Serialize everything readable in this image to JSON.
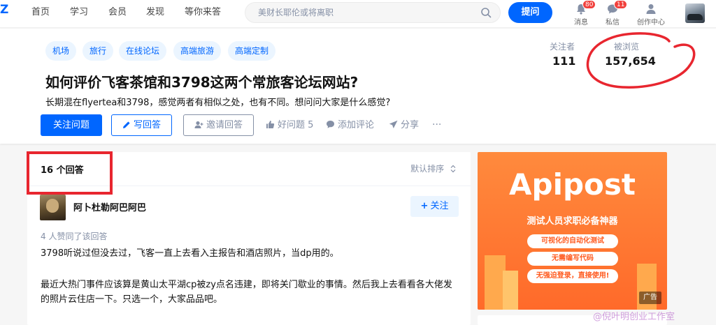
{
  "topbar": {
    "logo": "Z",
    "nav": [
      "首页",
      "学习",
      "会员",
      "发现",
      "等你来答"
    ],
    "search_placeholder": "美财长耶伦或将离职",
    "ask_label": "提问",
    "notifications": {
      "label": "消息",
      "badge": "80"
    },
    "messages": {
      "label": "私信",
      "badge": "11"
    },
    "creator": {
      "label": "创作中心"
    }
  },
  "question": {
    "tags": [
      "机场",
      "旅行",
      "在线论坛",
      "高端旅游",
      "高端定制"
    ],
    "title": "如何评价飞客茶馆和3798这两个常旅客论坛网站?",
    "description": "长期混在flyertea和3798，感觉两者有相似之处，也有不同。想问问大家是什么感觉?",
    "followers_label": "关注者",
    "followers_value": "111",
    "views_label": "被浏览",
    "views_value": "157,654",
    "actions": {
      "follow": "关注问题",
      "write": "写回答",
      "invite": "邀请回答",
      "good_question": "好问题 5",
      "comment": "添加评论",
      "share": "分享",
      "more": "···"
    }
  },
  "answers": {
    "count_label": "16 个回答",
    "sort_label": "默认排序",
    "author_name": "阿卜杜勒阿巴阿巴",
    "follow_label": "关注",
    "voters": "4 人赞同了该回答",
    "paragraphs": [
      "3798听说过但没去过，飞客一直上去看入主报告和酒店照片，当dp用的。",
      "最近大热门事件应该算是黄山太平湖cp被zy点名违建，即将关门歇业的事情。然后我上去看看各大佬发的照片云住店一下。只选一个，大家品品吧。"
    ]
  },
  "ad": {
    "brand": "Apipost",
    "subtitle": "测试人员求职必备神器",
    "pills": [
      "可视化的自动化测试",
      "无需编写代码",
      "无强迫登录，直接使用!"
    ],
    "label": "广告"
  },
  "watermark": "@倪叶明创业工作室",
  "colors": {
    "brand": "#0066ff",
    "annotation": "#e8262f",
    "ad": "#ff6a2a"
  }
}
